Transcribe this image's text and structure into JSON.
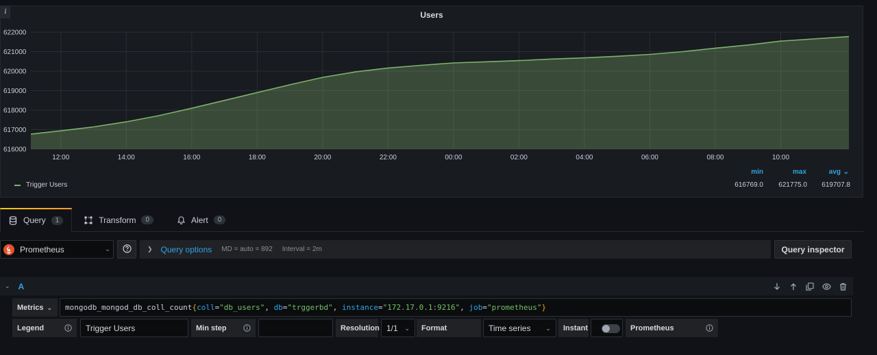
{
  "panel": {
    "title": "Users",
    "info_icon": "i"
  },
  "chart_data": {
    "type": "area",
    "title": "Users",
    "xlabel": "",
    "ylabel": "",
    "y_ticks": [
      "622000",
      "621000",
      "620000",
      "619000",
      "618000",
      "617000",
      "616000"
    ],
    "x_ticks": [
      "12:00",
      "14:00",
      "16:00",
      "18:00",
      "20:00",
      "22:00",
      "00:00",
      "02:00",
      "04:00",
      "06:00",
      "08:00",
      "10:00"
    ],
    "ylim": [
      616000,
      622000
    ],
    "grid": true,
    "series": [
      {
        "name": "Trigger Users",
        "color": "#7eb26d",
        "x": [
          "11:05",
          "12:00",
          "13:00",
          "14:00",
          "15:00",
          "16:00",
          "17:00",
          "18:00",
          "19:00",
          "20:00",
          "21:00",
          "22:00",
          "23:00",
          "00:00",
          "01:00",
          "02:00",
          "03:00",
          "04:00",
          "05:00",
          "06:00",
          "07:00",
          "08:00",
          "09:00",
          "10:00",
          "11:05"
        ],
        "values": [
          616770,
          616940,
          617140,
          617400,
          617720,
          618100,
          618500,
          618900,
          619300,
          619680,
          619960,
          620160,
          620300,
          620420,
          620480,
          620540,
          620620,
          620680,
          620760,
          620860,
          621000,
          621180,
          621340,
          621540,
          621775
        ]
      }
    ],
    "legend": {
      "placement": "bottom",
      "columns": [
        "min",
        "max",
        "avg"
      ],
      "sort_indicator": "avg",
      "values": {
        "min": "616769.0",
        "max": "621775.0",
        "avg": "619707.8"
      }
    }
  },
  "tabs": [
    {
      "label": "Query",
      "count": "1",
      "icon": "database-icon",
      "active": true
    },
    {
      "label": "Transform",
      "count": "0",
      "icon": "transform-icon",
      "active": false
    },
    {
      "label": "Alert",
      "count": "0",
      "icon": "bell-icon",
      "active": false
    }
  ],
  "datasource": {
    "name": "Prometheus",
    "icon": "prometheus-logo"
  },
  "query_options": {
    "label": "Query options",
    "md": "MD = auto = 892",
    "interval": "Interval = 2m"
  },
  "query_inspector": "Query inspector",
  "query": {
    "ref": "A",
    "metrics_label": "Metrics",
    "metric_name": "mongodb_mongod_db_coll_count",
    "open_brace": "{",
    "close_brace": "}",
    "labels": [
      {
        "key": "coll",
        "eq": "=",
        "value": "\"db_users\"",
        "sep": ", "
      },
      {
        "key": "db",
        "eq": "=",
        "value": "\"trggerbd\"",
        "sep": ", "
      },
      {
        "key": "instance",
        "eq": "=",
        "value": "\"172.17.0.1:9216\"",
        "sep": ", "
      },
      {
        "key": "job",
        "eq": "=",
        "value": "\"prometheus\"",
        "sep": ""
      }
    ],
    "legend_label": "Legend",
    "legend_value": "Trigger Users",
    "minstep_label": "Min step",
    "minstep_value": "",
    "resolution_label": "Resolution",
    "resolution_value": "1/1",
    "format_label": "Format",
    "format_value": "Time series",
    "instant_label": "Instant",
    "instant_on": false,
    "source_label": "Prometheus"
  },
  "colors": {
    "accent_blue": "#33a2e5",
    "series_green": "#7eb26d",
    "tab_gradient_start": "#f2cc0c",
    "tab_gradient_end": "#ff9830",
    "prometheus_orange": "#e6522c"
  }
}
